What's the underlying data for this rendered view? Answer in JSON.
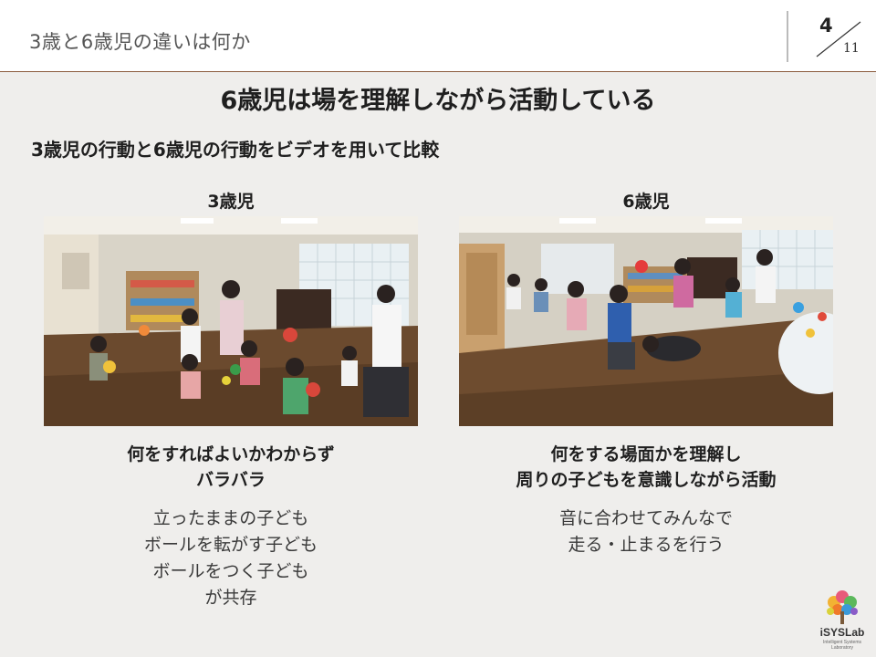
{
  "header": {
    "title": "3歳と6歳児の違いは何か",
    "page_current": "4",
    "page_total": "11"
  },
  "headline": "6歳児は場を理解しながら活動している",
  "subheadline": "3歳児の行動と6歳児の行動をビデオを用いて比較",
  "left": {
    "label": "3歳児",
    "summary": [
      "何をすればよいかわからず",
      "バラバラ"
    ],
    "details": [
      "立ったままの子ども",
      "ボールを転がす子ども",
      "ボールをつく子ども",
      "が共存"
    ]
  },
  "right": {
    "label": "6歳児",
    "summary": [
      "何をする場面かを理解し",
      "周りの子どもを意識しながら活動"
    ],
    "details": [
      "音に合わせてみんなで",
      "走る・止まるを行う"
    ]
  },
  "logo": {
    "name": "iSYSLab",
    "subtitle": "Intelligent Systems Laboratory"
  },
  "colors": {
    "background": "#efeeec",
    "header_rule": "#8a5a3c",
    "floor": "#6b4a2e"
  }
}
